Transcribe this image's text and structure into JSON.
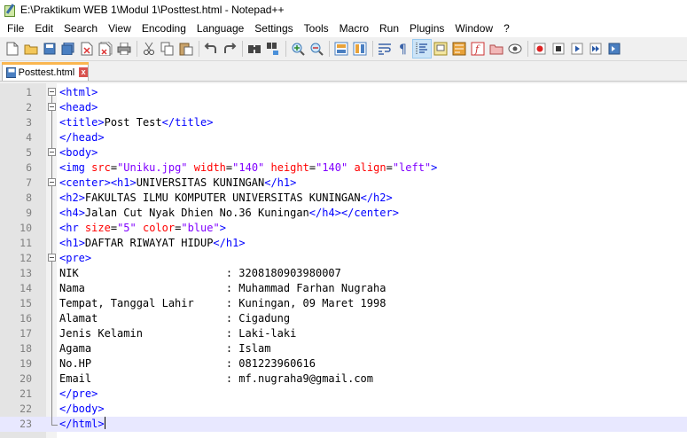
{
  "window": {
    "title": "E:\\Praktikum WEB 1\\Modul 1\\Posttest.html - Notepad++"
  },
  "menu": [
    "File",
    "Edit",
    "Search",
    "View",
    "Encoding",
    "Language",
    "Settings",
    "Tools",
    "Macro",
    "Run",
    "Plugins",
    "Window",
    "?"
  ],
  "tab": {
    "label": "Posttest.html",
    "close": "x"
  },
  "editor": {
    "current_line": 23,
    "lines": [
      {
        "n": "1",
        "code": "<html>"
      },
      {
        "n": "2",
        "code": "<head>"
      },
      {
        "n": "3",
        "code": "<title>Post Test</title>"
      },
      {
        "n": "4",
        "code": "</head>"
      },
      {
        "n": "5",
        "code": "<body>"
      },
      {
        "n": "6",
        "code": "<img src=\"Uniku.jpg\" width=\"140\" height=\"140\" align=\"left\">"
      },
      {
        "n": "7",
        "code": "<center><h1>UNIVERSITAS KUNINGAN</h1>"
      },
      {
        "n": "8",
        "code": "<h2>FAKULTAS ILMU KOMPUTER UNIVERSITAS KUNINGAN</h2>"
      },
      {
        "n": "9",
        "code": "<h4>Jalan Cut Nyak Dhien No.36 Kuningan</h4></center>"
      },
      {
        "n": "10",
        "code": "<hr size=\"5\" color=\"blue\">"
      },
      {
        "n": "11",
        "code": "<h1>DAFTAR RIWAYAT HIDUP</h1>"
      },
      {
        "n": "12",
        "code": "<pre>"
      },
      {
        "n": "13",
        "code": "NIK                       : 3208180903980007"
      },
      {
        "n": "14",
        "code": "Nama                      : Muhammad Farhan Nugraha"
      },
      {
        "n": "15",
        "code": "Tempat, Tanggal Lahir     : Kuningan, 09 Maret 1998"
      },
      {
        "n": "16",
        "code": "Alamat                    : Cigadung"
      },
      {
        "n": "17",
        "code": "Jenis Kelamin             : Laki-laki"
      },
      {
        "n": "18",
        "code": "Agama                     : Islam"
      },
      {
        "n": "19",
        "code": "No.HP                     : 081223960616"
      },
      {
        "n": "20",
        "code": "Email                     : mf.nugraha9@gmail.com"
      },
      {
        "n": "21",
        "code": "</pre>"
      },
      {
        "n": "22",
        "code": "</body>"
      },
      {
        "n": "23",
        "code": "</html>"
      }
    ]
  },
  "colors": {
    "tag": "#0000ff",
    "attr": "#ff0000",
    "value": "#8000ff",
    "tab_accent": "#fab650"
  }
}
